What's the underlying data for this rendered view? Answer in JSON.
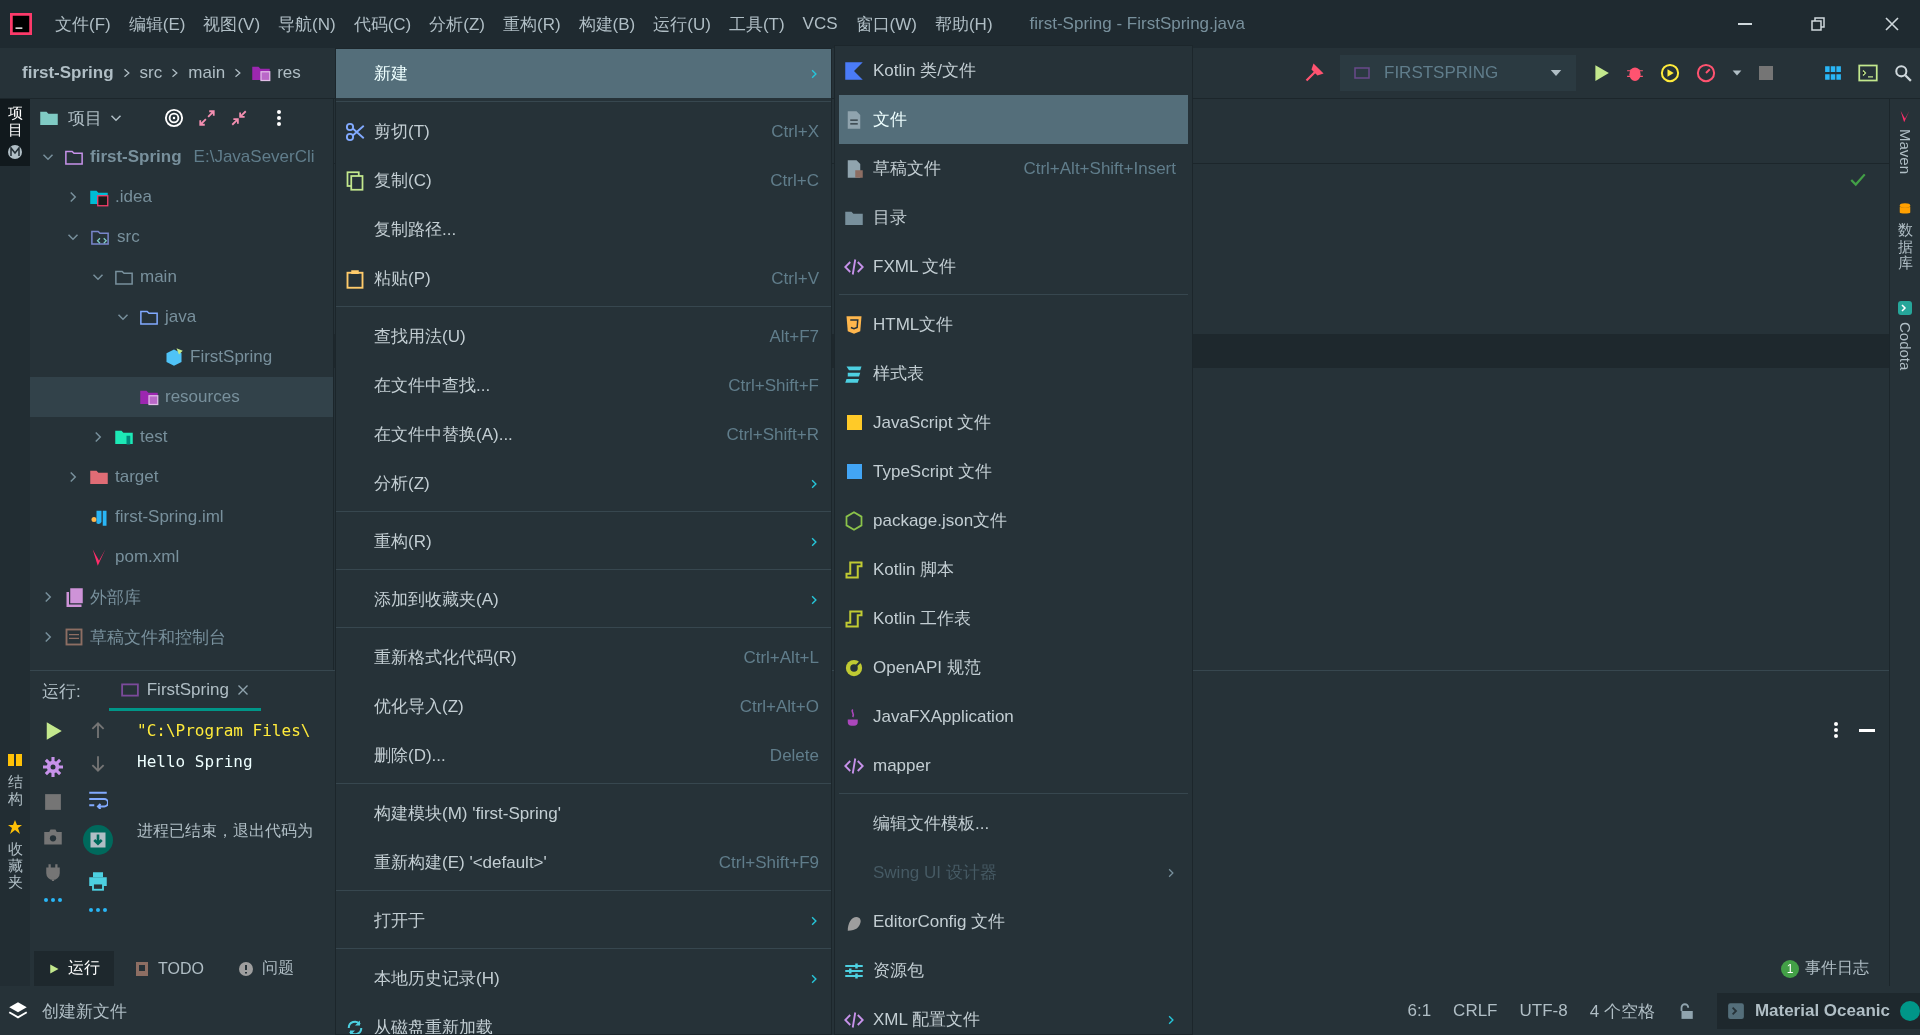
{
  "window": {
    "title": "first-Spring - FirstSpring.java"
  },
  "menu_bar": [
    "文件(F)",
    "编辑(E)",
    "视图(V)",
    "导航(N)",
    "代码(C)",
    "分析(Z)",
    "重构(R)",
    "构建(B)",
    "运行(U)",
    "工具(T)",
    "VCS",
    "窗口(W)",
    "帮助(H)"
  ],
  "breadcrumbs": [
    {
      "label": "first-Spring",
      "kind": "project"
    },
    {
      "label": "src",
      "kind": "plain"
    },
    {
      "label": "main",
      "kind": "plain"
    },
    {
      "label": "res",
      "kind": "resources"
    }
  ],
  "run_config": {
    "label": "FIRSTSPRING"
  },
  "left_tool_strip": [
    {
      "label": "项目",
      "selected": true,
      "kind": "project"
    },
    {
      "label": "结构",
      "selected": false,
      "kind": "structure"
    },
    {
      "label": "收藏夹",
      "selected": false,
      "kind": "favorites"
    }
  ],
  "right_tool_strip": [
    {
      "label": "Maven",
      "kind": "maven"
    },
    {
      "label": "数据库",
      "kind": "database"
    },
    {
      "label": "Codota",
      "kind": "codota"
    }
  ],
  "project_panel": {
    "title": "项目",
    "tree": [
      {
        "label": "first-Spring",
        "detail": "E:\\JavaSeverCli",
        "kind": "module",
        "expanded": true,
        "selected": false,
        "children": [
          {
            "label": ".idea",
            "kind": "idea",
            "expanded": false,
            "selected": false
          },
          {
            "label": "src",
            "kind": "source",
            "expanded": true,
            "selected": false,
            "children": [
              {
                "label": "main",
                "kind": "folder",
                "expanded": true,
                "selected": false,
                "children": [
                  {
                    "label": "java",
                    "kind": "java",
                    "expanded": true,
                    "selected": false,
                    "children": [
                      {
                        "label": "FirstSpring",
                        "kind": "class",
                        "selected": false
                      }
                    ]
                  },
                  {
                    "label": "resources",
                    "kind": "resources",
                    "selected": true
                  }
                ]
              },
              {
                "label": "test",
                "kind": "test",
                "expanded": false,
                "selected": false
              }
            ]
          },
          {
            "label": "target",
            "kind": "excluded",
            "expanded": false,
            "selected": false
          },
          {
            "label": "first-Spring.iml",
            "kind": "iml",
            "selected": false
          },
          {
            "label": "pom.xml",
            "kind": "maven",
            "selected": false
          }
        ]
      },
      {
        "label": "外部库",
        "kind": "library",
        "expanded": false,
        "selected": false
      },
      {
        "label": "草稿文件和控制台",
        "kind": "scratch",
        "expanded": false,
        "selected": false
      }
    ]
  },
  "run_panel": {
    "label": "运行:",
    "tab": {
      "label": "FirstSpring",
      "selected": true
    },
    "console": [
      {
        "text": "\"C:\\Program Files\\",
        "kind": "command"
      },
      {
        "text": "Hello Spring",
        "kind": "output"
      },
      {
        "text": "进程已结束，退出代码为",
        "kind": "exit"
      }
    ]
  },
  "tool_tabs": [
    {
      "label": "运行",
      "kind": "run",
      "selected": true
    },
    {
      "label": "TODO",
      "kind": "todo",
      "selected": false
    },
    {
      "label": "问题",
      "kind": "problems",
      "selected": false
    }
  ],
  "event_log": {
    "count": "1",
    "label": "事件日志"
  },
  "status_bar": {
    "message": "创建新文件",
    "items": [
      "6:1",
      "CRLF",
      "UTF-8",
      "4 个空格"
    ],
    "theme": "Material Oceanic"
  },
  "context_menu": {
    "groups": [
      [
        {
          "label": "新建",
          "selected": true,
          "submenu": true
        }
      ],
      [
        {
          "label": "剪切(T)",
          "shortcut": "Ctrl+X",
          "kind": "cut",
          "selected": false,
          "submenu": false
        },
        {
          "label": "复制(C)",
          "shortcut": "Ctrl+C",
          "kind": "copy",
          "selected": false,
          "submenu": false
        },
        {
          "label": "复制路径...",
          "selected": false,
          "submenu": false
        },
        {
          "label": "粘贴(P)",
          "shortcut": "Ctrl+V",
          "kind": "paste",
          "selected": false,
          "submenu": false
        }
      ],
      [
        {
          "label": "查找用法(U)",
          "shortcut": "Alt+F7",
          "selected": false,
          "submenu": false
        },
        {
          "label": "在文件中查找...",
          "shortcut": "Ctrl+Shift+F",
          "selected": false,
          "submenu": false
        },
        {
          "label": "在文件中替换(A)...",
          "shortcut": "Ctrl+Shift+R",
          "selected": false,
          "submenu": false
        },
        {
          "label": "分析(Z)",
          "selected": false,
          "submenu": true
        }
      ],
      [
        {
          "label": "重构(R)",
          "selected": false,
          "submenu": true
        }
      ],
      [
        {
          "label": "添加到收藏夹(A)",
          "selected": false,
          "submenu": true
        }
      ],
      [
        {
          "label": "重新格式化代码(R)",
          "shortcut": "Ctrl+Alt+L",
          "selected": false,
          "submenu": false
        },
        {
          "label": "优化导入(Z)",
          "shortcut": "Ctrl+Alt+O",
          "selected": false,
          "submenu": false
        },
        {
          "label": "删除(D)...",
          "shortcut": "Delete",
          "selected": false,
          "submenu": false
        }
      ],
      [
        {
          "label": "构建模块(M) 'first-Spring'",
          "selected": false,
          "submenu": false
        },
        {
          "label": "重新构建(E) '<default>'",
          "shortcut": "Ctrl+Shift+F9",
          "selected": false,
          "submenu": false
        }
      ],
      [
        {
          "label": "打开于",
          "selected": false,
          "submenu": true
        }
      ],
      [
        {
          "label": "本地历史记录(H)",
          "selected": false,
          "submenu": true
        },
        {
          "label": "从磁盘重新加载",
          "kind": "reload",
          "selected": false,
          "submenu": false
        }
      ]
    ]
  },
  "new_submenu": {
    "groups": [
      [
        {
          "label": "Kotlin 类/文件",
          "kind": "kotlin",
          "selected": false,
          "disabled": false,
          "submenu": false
        },
        {
          "label": "文件",
          "kind": "file",
          "selected": true,
          "disabled": false,
          "submenu": false
        },
        {
          "label": "草稿文件",
          "shortcut": "Ctrl+Alt+Shift+Insert",
          "kind": "scratch",
          "selected": false,
          "disabled": false,
          "submenu": false
        },
        {
          "label": "目录",
          "kind": "folder",
          "selected": false,
          "disabled": false,
          "submenu": false
        },
        {
          "label": "FXML 文件",
          "kind": "code",
          "selected": false,
          "disabled": false,
          "submenu": false
        }
      ],
      [
        {
          "label": "HTML文件",
          "kind": "html",
          "selected": false,
          "disabled": false,
          "submenu": false
        },
        {
          "label": "样式表",
          "kind": "css",
          "selected": false,
          "disabled": false,
          "submenu": false
        },
        {
          "label": "JavaScript 文件",
          "kind": "js",
          "selected": false,
          "disabled": false,
          "submenu": false
        },
        {
          "label": "TypeScript 文件",
          "kind": "ts",
          "selected": false,
          "disabled": false,
          "submenu": false
        },
        {
          "label": "package.json文件",
          "kind": "node",
          "selected": false,
          "disabled": false,
          "submenu": false
        },
        {
          "label": "Kotlin 脚本",
          "kind": "kscript",
          "selected": false,
          "disabled": false,
          "submenu": false
        },
        {
          "label": "Kotlin 工作表",
          "kind": "kscript",
          "selected": false,
          "disabled": false,
          "submenu": false
        },
        {
          "label": "OpenAPI 规范",
          "kind": "openapi",
          "selected": false,
          "disabled": false,
          "submenu": false
        },
        {
          "label": "JavaFXApplication",
          "kind": "java",
          "selected": false,
          "disabled": false,
          "submenu": false
        },
        {
          "label": "mapper",
          "kind": "code",
          "selected": false,
          "disabled": false,
          "submenu": false
        }
      ],
      [
        {
          "label": "编辑文件模板...",
          "selected": false,
          "disabled": false,
          "submenu": false
        },
        {
          "label": "Swing UI 设计器",
          "selected": false,
          "disabled": true,
          "submenu": true
        },
        {
          "label": "EditorConfig 文件",
          "kind": "editorconfig",
          "selected": false,
          "disabled": false,
          "submenu": false
        },
        {
          "label": "资源包",
          "kind": "bundle",
          "selected": false,
          "disabled": false,
          "submenu": false
        },
        {
          "label": "XML 配置文件",
          "kind": "code",
          "selected": false,
          "disabled": false,
          "submenu": true
        }
      ]
    ]
  }
}
